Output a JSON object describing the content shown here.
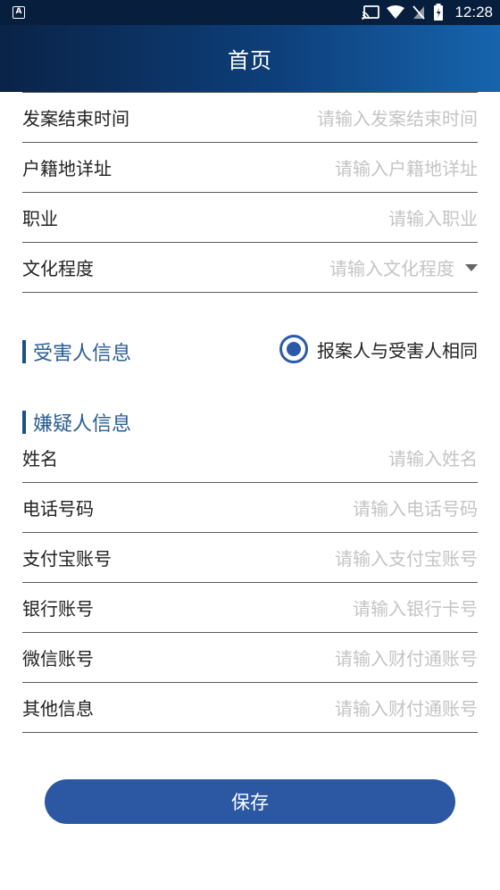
{
  "statusbar": {
    "time": "12:28",
    "left_icon_glyph": "A"
  },
  "appbar": {
    "title": "首页"
  },
  "form_top": [
    {
      "label": "发案结束时间",
      "placeholder": "请输入发案结束时间"
    },
    {
      "label": "户籍地详址",
      "placeholder": "请输入户籍地详址"
    },
    {
      "label": "职业",
      "placeholder": "请输入职业"
    },
    {
      "label": "文化程度",
      "placeholder": "请输入文化程度"
    }
  ],
  "victim_section": {
    "title": "受害人信息",
    "radio_label": "报案人与受害人相同",
    "radio_checked": true
  },
  "suspect_section": {
    "title": "嫌疑人信息"
  },
  "suspect_fields": [
    {
      "label": "姓名",
      "placeholder": "请输入姓名"
    },
    {
      "label": "电话号码",
      "placeholder": "请输入电话号码"
    },
    {
      "label": "支付宝账号",
      "placeholder": "请输入支付宝账号"
    },
    {
      "label": "银行账号",
      "placeholder": "请输入银行卡号"
    },
    {
      "label": "微信账号",
      "placeholder": "请输入财付通账号"
    },
    {
      "label": "其他信息",
      "placeholder": "请输入财付通账号"
    }
  ],
  "save_button": {
    "label": "保存"
  },
  "colors": {
    "appbar_start": "#0a2347",
    "appbar_end": "#1764ad",
    "accent": "#2c58a3",
    "section_title": "#2a5d94"
  },
  "icons": [
    "cast-icon",
    "wifi-icon",
    "no-sim-icon",
    "battery-icon",
    "dropdown-arrow-icon",
    "radio-checked-icon"
  ]
}
